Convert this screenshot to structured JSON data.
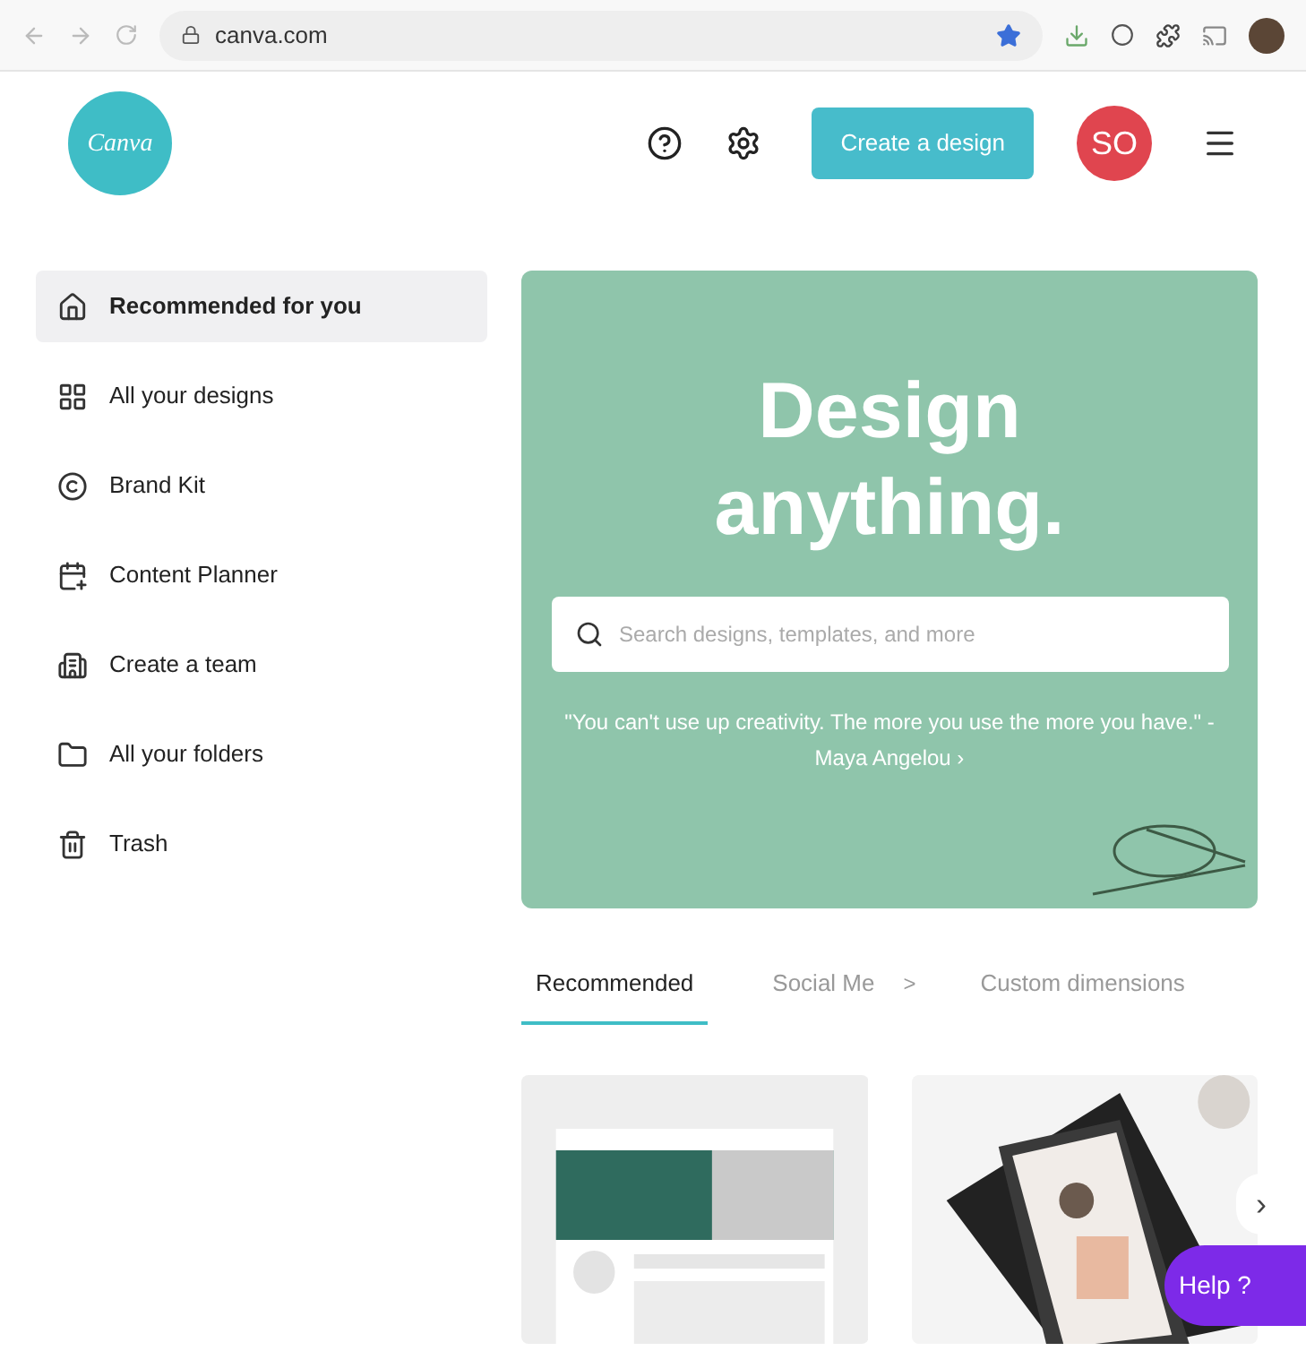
{
  "browser": {
    "url": "canva.com"
  },
  "header": {
    "logo": "Canva",
    "create_button": "Create a design",
    "avatar": "SO"
  },
  "sidebar": {
    "items": [
      {
        "label": "Recommended for you",
        "selected": true
      },
      {
        "label": "All your designs",
        "selected": false
      },
      {
        "label": "Brand Kit",
        "selected": false
      },
      {
        "label": "Content Planner",
        "selected": false
      },
      {
        "label": "Create a team",
        "selected": false
      },
      {
        "label": "All your folders",
        "selected": false
      },
      {
        "label": "Trash",
        "selected": false
      }
    ]
  },
  "hero": {
    "title_lines": [
      "Design",
      "anything."
    ],
    "search": {
      "placeholder": "Search designs, templates, and more"
    },
    "quote": "\"You can't use up creativity. The more you use the more you have.\" - Maya Angelou ›"
  },
  "tabs": [
    {
      "label": "Recommended",
      "selected": true
    },
    {
      "label": "Social Me",
      "selected": false
    },
    {
      "label": "Custom dimensions",
      "selected": false
    }
  ],
  "tab_scroll": ">",
  "next_arrow": "›",
  "help_button": "Help ?"
}
